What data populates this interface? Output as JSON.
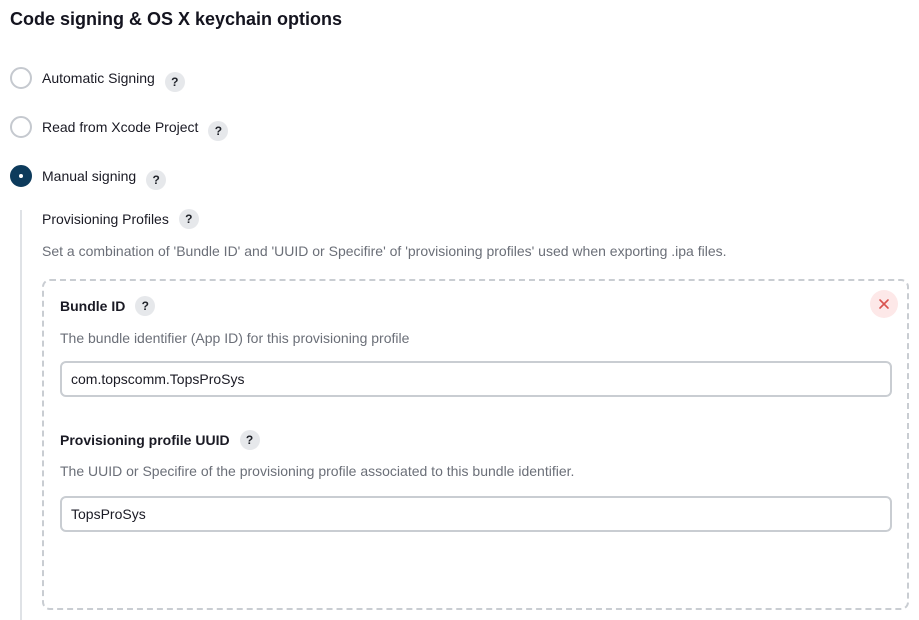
{
  "section": {
    "title": "Code signing & OS X keychain options"
  },
  "signing_options": [
    {
      "label": "Automatic Signing",
      "selected": false,
      "help": "?"
    },
    {
      "label": "Read from Xcode Project",
      "selected": false,
      "help": "?"
    },
    {
      "label": "Manual signing",
      "selected": true,
      "help": "?"
    }
  ],
  "provisioning": {
    "title": "Provisioning Profiles",
    "help": "?",
    "description": "Set a combination of 'Bundle ID' and 'UUID or Specifire' of 'provisioning profiles' used when exporting .ipa files.",
    "profiles": [
      {
        "bundle_id": {
          "label": "Bundle ID",
          "help": "?",
          "description": "The bundle identifier (App ID) for this provisioning profile",
          "value": "com.topscomm.TopsProSys"
        },
        "uuid": {
          "label": "Provisioning profile UUID",
          "help": "?",
          "description": "The UUID or Specifire of the provisioning profile associated to this bundle identifier.",
          "value": "TopsProSys"
        },
        "delete_icon": "close-icon"
      }
    ]
  },
  "colors": {
    "radio_selected": "#0d3b5c",
    "radio_border": "#c5c9cf",
    "delete_bg": "#fde8e8",
    "delete_x": "#d9534f",
    "muted_text": "#6b6f78"
  }
}
